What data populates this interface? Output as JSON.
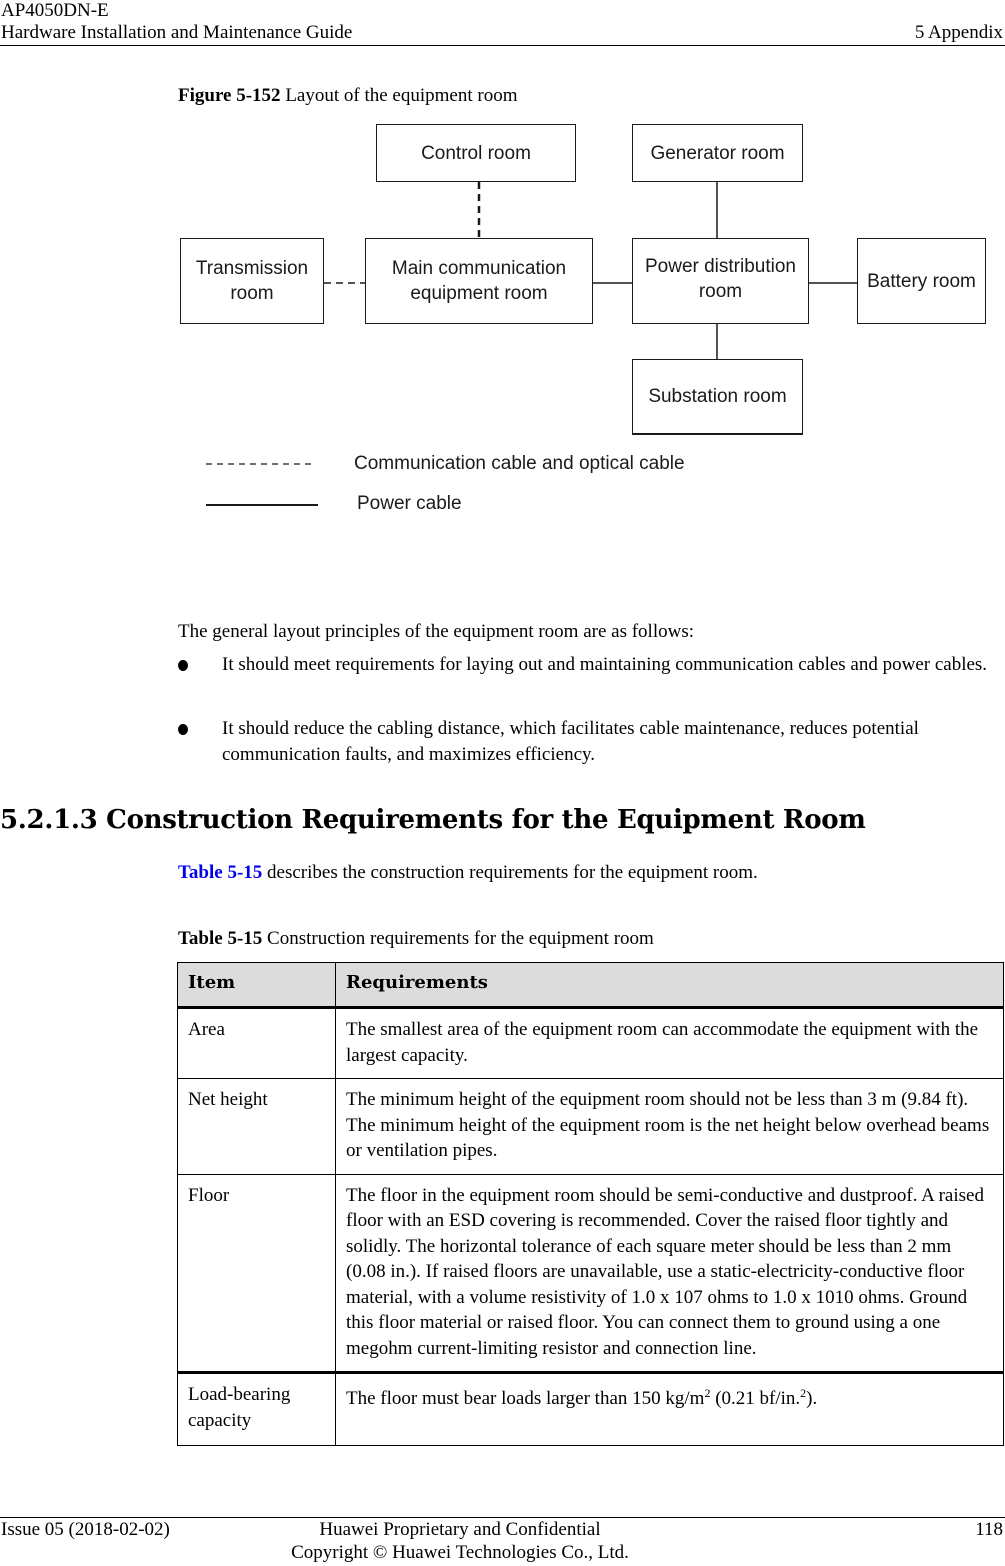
{
  "header": {
    "product": "AP4050DN-E",
    "guide_title": "Hardware Installation and Maintenance Guide",
    "chapter": "5 Appendix"
  },
  "figure": {
    "number": "Figure 5-152",
    "title": "Layout of the equipment room",
    "rooms": {
      "control": "Control room",
      "generator": "Generator room",
      "transmission_line1": "Transmission",
      "transmission_line2": "room",
      "main_comm_line1": "Main communication",
      "main_comm_line2": "equipment room",
      "power_dist_line1": "Power distribution",
      "power_dist_line2": "room",
      "battery": "Battery room",
      "substation": "Substation room"
    },
    "connections": [
      {
        "from": "Control room",
        "to": "Main communication equipment room",
        "type": "communication"
      },
      {
        "from": "Transmission room",
        "to": "Main communication equipment room",
        "type": "communication"
      },
      {
        "from": "Main communication equipment room",
        "to": "Power distribution room",
        "type": "power"
      },
      {
        "from": "Generator room",
        "to": "Power distribution room",
        "type": "power"
      },
      {
        "from": "Power distribution room",
        "to": "Battery room",
        "type": "power"
      },
      {
        "from": "Power distribution room",
        "to": "Substation room",
        "type": "power"
      }
    ],
    "legend": {
      "communication": "Communication cable and optical cable",
      "power": "Power cable"
    }
  },
  "body": {
    "intro": "The general layout principles of the equipment room are as follows:",
    "bullets": [
      "It should meet requirements for laying out and maintaining communication cables and power cables.",
      "It should reduce the cabling distance, which facilitates cable maintenance, reduces potential communication faults, and maximizes efficiency."
    ]
  },
  "section": {
    "title": "5.2.1.3 Construction Requirements for the Equipment Room",
    "intro_link": "Table 5-15",
    "intro_rest": " describes the construction requirements for the equipment room."
  },
  "table": {
    "caption_number": "Table 5-15",
    "caption_title": " Construction requirements for the equipment room",
    "headers": [
      "Item",
      "Requirements"
    ],
    "rows": [
      {
        "item": "Area",
        "requirement": "The smallest area of the equipment room can accommodate the equipment with the largest capacity."
      },
      {
        "item": "Net height",
        "requirement": "The minimum height of the equipment room should not be less than 3 m (9.84 ft). The minimum height of the equipment room is the net height below overhead beams or ventilation pipes."
      },
      {
        "item": "Floor",
        "requirement": "The floor in the equipment room should be semi-conductive and dustproof. A raised floor with an ESD covering is recommended. Cover the raised floor tightly and solidly. The horizontal tolerance of each square meter should be less than 2 mm (0.08 in.). If raised floors are unavailable, use a static-electricity-conductive floor material, with a volume resistivity of 1.0 x 107 ohms to 1.0 x 1010 ohms. Ground this floor material or raised floor. You can connect them to ground using a one megohm current-limiting resistor and connection line."
      },
      {
        "item": "Load-bearing capacity",
        "requirement_pre": "The floor must bear loads larger than 150 kg/m",
        "sup1": "2",
        "requirement_mid": " (0.21 bf/in.",
        "sup2": "2",
        "requirement_post": ")."
      }
    ]
  },
  "footer": {
    "issue": "Issue 05 (2018-02-02)",
    "confidential": "Huawei Proprietary and Confidential",
    "copyright": "Copyright © Huawei Technologies Co., Ltd.",
    "page": "118"
  }
}
